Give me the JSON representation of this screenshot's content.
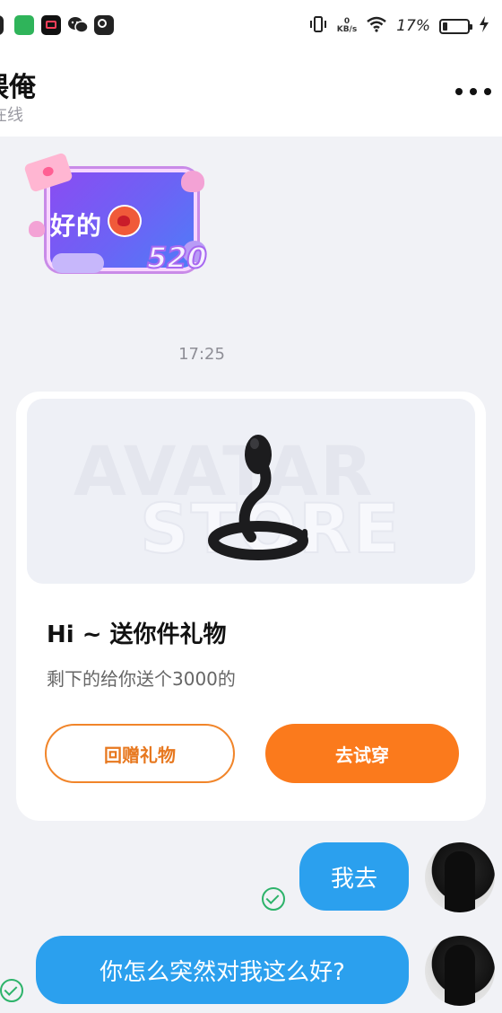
{
  "status_bar": {
    "net_speed_top": "0",
    "net_speed_bottom": "KB/s",
    "battery_percent": "17%",
    "icons": [
      "app-icon",
      "app-icon",
      "video-app-icon",
      "wechat-icon",
      "app-icon",
      "vibrate-icon",
      "wifi-icon",
      "battery-icon",
      "charging-icon"
    ]
  },
  "header": {
    "contact_name": "偎俺",
    "contact_status": "在线",
    "more_icon": "more-dots-icon"
  },
  "sticker": {
    "text": "好的",
    "number": "520"
  },
  "timestamp": "17:25",
  "gift_card": {
    "watermark_line1": "AVATAR",
    "watermark_line2": "STORE",
    "item_icon": "snake-icon",
    "title": "Hi ~ 送你件礼物",
    "description": "剩下的给你送个3000的",
    "return_button": "回赠礼物",
    "try_button": "去试穿"
  },
  "messages": [
    {
      "text": "我去",
      "status": "read"
    },
    {
      "text": "你怎么突然对我这么好?",
      "status": "read"
    }
  ],
  "colors": {
    "bubble": "#2ba0ee",
    "accent_orange": "#fb7a1c",
    "read_check": "#2db36a"
  }
}
